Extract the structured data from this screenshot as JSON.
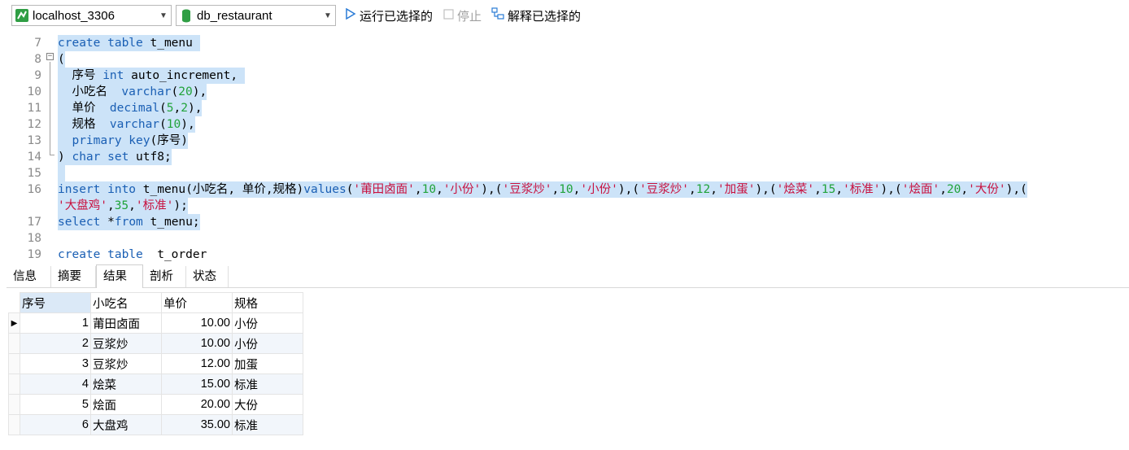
{
  "toolbar": {
    "connection": "localhost_3306",
    "database": "db_restaurant",
    "run_selected": "运行已选择的",
    "stop": "停止",
    "explain_selected": "解释已选择的",
    "icons": [
      "connection-icon",
      "database-icon",
      "run-icon",
      "stop-icon",
      "explain-icon"
    ]
  },
  "editor": {
    "lines": [
      {
        "num": "7",
        "parts": [
          {
            "t": "create table",
            "c": "kw"
          },
          {
            "t": " t_menu "
          }
        ]
      },
      {
        "num": "8",
        "parts": [
          {
            "t": "("
          }
        ]
      },
      {
        "num": "9",
        "parts": [
          {
            "t": "  序号 "
          },
          {
            "t": "int",
            "c": "kw"
          },
          {
            "t": " auto_increment, "
          }
        ]
      },
      {
        "num": "10",
        "parts": [
          {
            "t": "  小吃名  "
          },
          {
            "t": "varchar",
            "c": "kw"
          },
          {
            "t": "("
          },
          {
            "t": "20",
            "c": "num"
          },
          {
            "t": "),"
          }
        ]
      },
      {
        "num": "11",
        "parts": [
          {
            "t": "  单价  "
          },
          {
            "t": "decimal",
            "c": "kw"
          },
          {
            "t": "("
          },
          {
            "t": "5",
            "c": "num"
          },
          {
            "t": ","
          },
          {
            "t": "2",
            "c": "num"
          },
          {
            "t": "),"
          }
        ]
      },
      {
        "num": "12",
        "parts": [
          {
            "t": "  规格  "
          },
          {
            "t": "varchar",
            "c": "kw"
          },
          {
            "t": "("
          },
          {
            "t": "10",
            "c": "num"
          },
          {
            "t": "),"
          }
        ]
      },
      {
        "num": "13",
        "parts": [
          {
            "t": "  "
          },
          {
            "t": "primary key",
            "c": "kw"
          },
          {
            "t": "(序号)"
          }
        ]
      },
      {
        "num": "14",
        "parts": [
          {
            "t": ") "
          },
          {
            "t": "char set",
            "c": "kw"
          },
          {
            "t": " utf8;"
          }
        ]
      },
      {
        "num": "15",
        "parts": [
          {
            "t": " "
          }
        ]
      },
      {
        "num": "16",
        "parts": [
          {
            "t": "insert into",
            "c": "kw"
          },
          {
            "t": " t_menu(小吃名, 单价,规格)"
          },
          {
            "t": "values",
            "c": "kw"
          },
          {
            "t": "("
          },
          {
            "t": "'莆田卤面'",
            "c": "str"
          },
          {
            "t": ","
          },
          {
            "t": "10",
            "c": "num"
          },
          {
            "t": ","
          },
          {
            "t": "'小份'",
            "c": "str"
          },
          {
            "t": "),("
          },
          {
            "t": "'豆浆炒'",
            "c": "str"
          },
          {
            "t": ","
          },
          {
            "t": "10",
            "c": "num"
          },
          {
            "t": ","
          },
          {
            "t": "'小份'",
            "c": "str"
          },
          {
            "t": "),("
          },
          {
            "t": "'豆浆炒'",
            "c": "str"
          },
          {
            "t": ","
          },
          {
            "t": "12",
            "c": "num"
          },
          {
            "t": ","
          },
          {
            "t": "'加蛋'",
            "c": "str"
          },
          {
            "t": "),("
          },
          {
            "t": "'烩菜'",
            "c": "str"
          },
          {
            "t": ","
          },
          {
            "t": "15",
            "c": "num"
          },
          {
            "t": ","
          },
          {
            "t": "'标准'",
            "c": "str"
          },
          {
            "t": "),("
          },
          {
            "t": "'烩面'",
            "c": "str"
          },
          {
            "t": ","
          },
          {
            "t": "20",
            "c": "num"
          },
          {
            "t": ","
          },
          {
            "t": "'大份'",
            "c": "str"
          },
          {
            "t": "),("
          }
        ]
      },
      {
        "num": "",
        "parts": [
          {
            "t": "'大盘鸡'",
            "c": "str"
          },
          {
            "t": ","
          },
          {
            "t": "35",
            "c": "num"
          },
          {
            "t": ","
          },
          {
            "t": "'标准'",
            "c": "str"
          },
          {
            "t": ");"
          }
        ]
      },
      {
        "num": "17",
        "parts": [
          {
            "t": "select",
            "c": "kw"
          },
          {
            "t": " *"
          },
          {
            "t": "from",
            "c": "kw"
          },
          {
            "t": " t_menu;"
          }
        ]
      },
      {
        "num": "18",
        "parts": [
          {
            "t": ""
          }
        ]
      },
      {
        "num": "19",
        "parts": [
          {
            "t": "create table",
            "c": "kw"
          },
          {
            "t": "  t_order"
          }
        ]
      }
    ]
  },
  "tabs": [
    "信息",
    "摘要",
    "结果 1",
    "剖析",
    "状态"
  ],
  "active_tab": 2,
  "grid": {
    "columns": [
      "序号",
      "小吃名",
      "单价",
      "规格"
    ],
    "rows": [
      [
        "1",
        "莆田卤面",
        "10.00",
        "小份"
      ],
      [
        "2",
        "豆浆炒",
        "10.00",
        "小份"
      ],
      [
        "3",
        "豆浆炒",
        "12.00",
        "加蛋"
      ],
      [
        "4",
        "烩菜",
        "15.00",
        "标准"
      ],
      [
        "5",
        "烩面",
        "20.00",
        "大份"
      ],
      [
        "6",
        "大盘鸡",
        "35.00",
        "标准"
      ]
    ]
  },
  "colors": {
    "keyword": "#1a5fb4",
    "number": "#21a33a",
    "string": "#c8113f",
    "selection": "#cce3f8"
  }
}
